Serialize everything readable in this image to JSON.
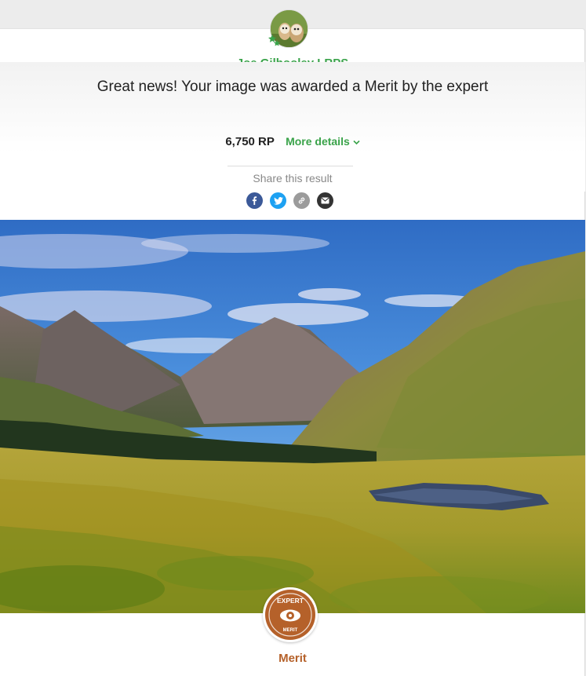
{
  "user": {
    "name": "Joe Gilhooley LRPS",
    "avatar_icon": "owls-avatar"
  },
  "result": {
    "headline": "Great news! Your image was awarded a Merit by the expert",
    "points": "6,750 RP",
    "more_details": "More details",
    "chevron": "⌄"
  },
  "share": {
    "label": "Share this result",
    "buttons": [
      {
        "icon": "facebook-icon",
        "color": "#3b5998"
      },
      {
        "icon": "twitter-icon",
        "color": "#1da1f2"
      },
      {
        "icon": "link-icon",
        "color": "#9b9b9b"
      },
      {
        "icon": "email-icon",
        "color": "#333333"
      }
    ]
  },
  "award": {
    "top_text": "EXPERT",
    "bottom_text": "MERIT",
    "label": "Merit",
    "color": "#b5612a"
  },
  "colors": {
    "accent_green": "#3aa34a",
    "merit_brown": "#b5612a"
  }
}
